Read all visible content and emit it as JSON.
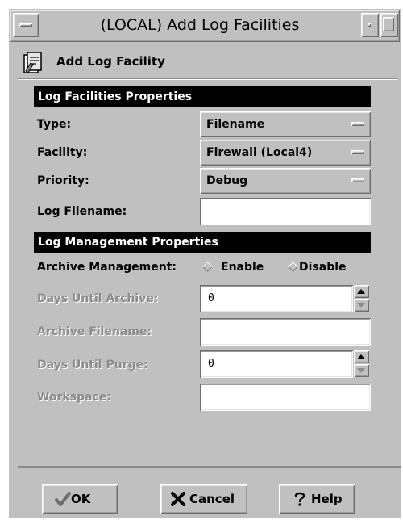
{
  "window": {
    "title": "(LOCAL) Add Log Facilities"
  },
  "header": {
    "title": "Add Log Facility",
    "icon": "log-facility-icon"
  },
  "sections": {
    "log_facilities": {
      "title": "Log Facilities Properties"
    },
    "log_management": {
      "title": "Log Management Properties"
    }
  },
  "fields": {
    "type": {
      "label": "Type:",
      "value": "Filename"
    },
    "facility": {
      "label": "Facility:",
      "value": "Firewall (Local4)"
    },
    "priority": {
      "label": "Priority:",
      "value": "Debug"
    },
    "log_filename": {
      "label": "Log Filename:",
      "value": ""
    },
    "archive_management": {
      "label": "Archive Management:",
      "options": [
        "Enable",
        "Disable"
      ],
      "selected": "Disable"
    },
    "days_until_archive": {
      "label": "Days Until Archive:",
      "value": "0"
    },
    "archive_filename": {
      "label": "Archive Filename:",
      "value": ""
    },
    "days_until_purge": {
      "label": "Days Until Purge:",
      "value": "0"
    },
    "workspace": {
      "label": "Workspace:",
      "value": ""
    }
  },
  "buttons": {
    "ok": "OK",
    "cancel": "Cancel",
    "help": "Help"
  },
  "colors": {
    "background": "#c0c0c0",
    "section_bar": "#000000",
    "section_text": "#ffffff",
    "disabled_text": "#8c8c8c"
  }
}
